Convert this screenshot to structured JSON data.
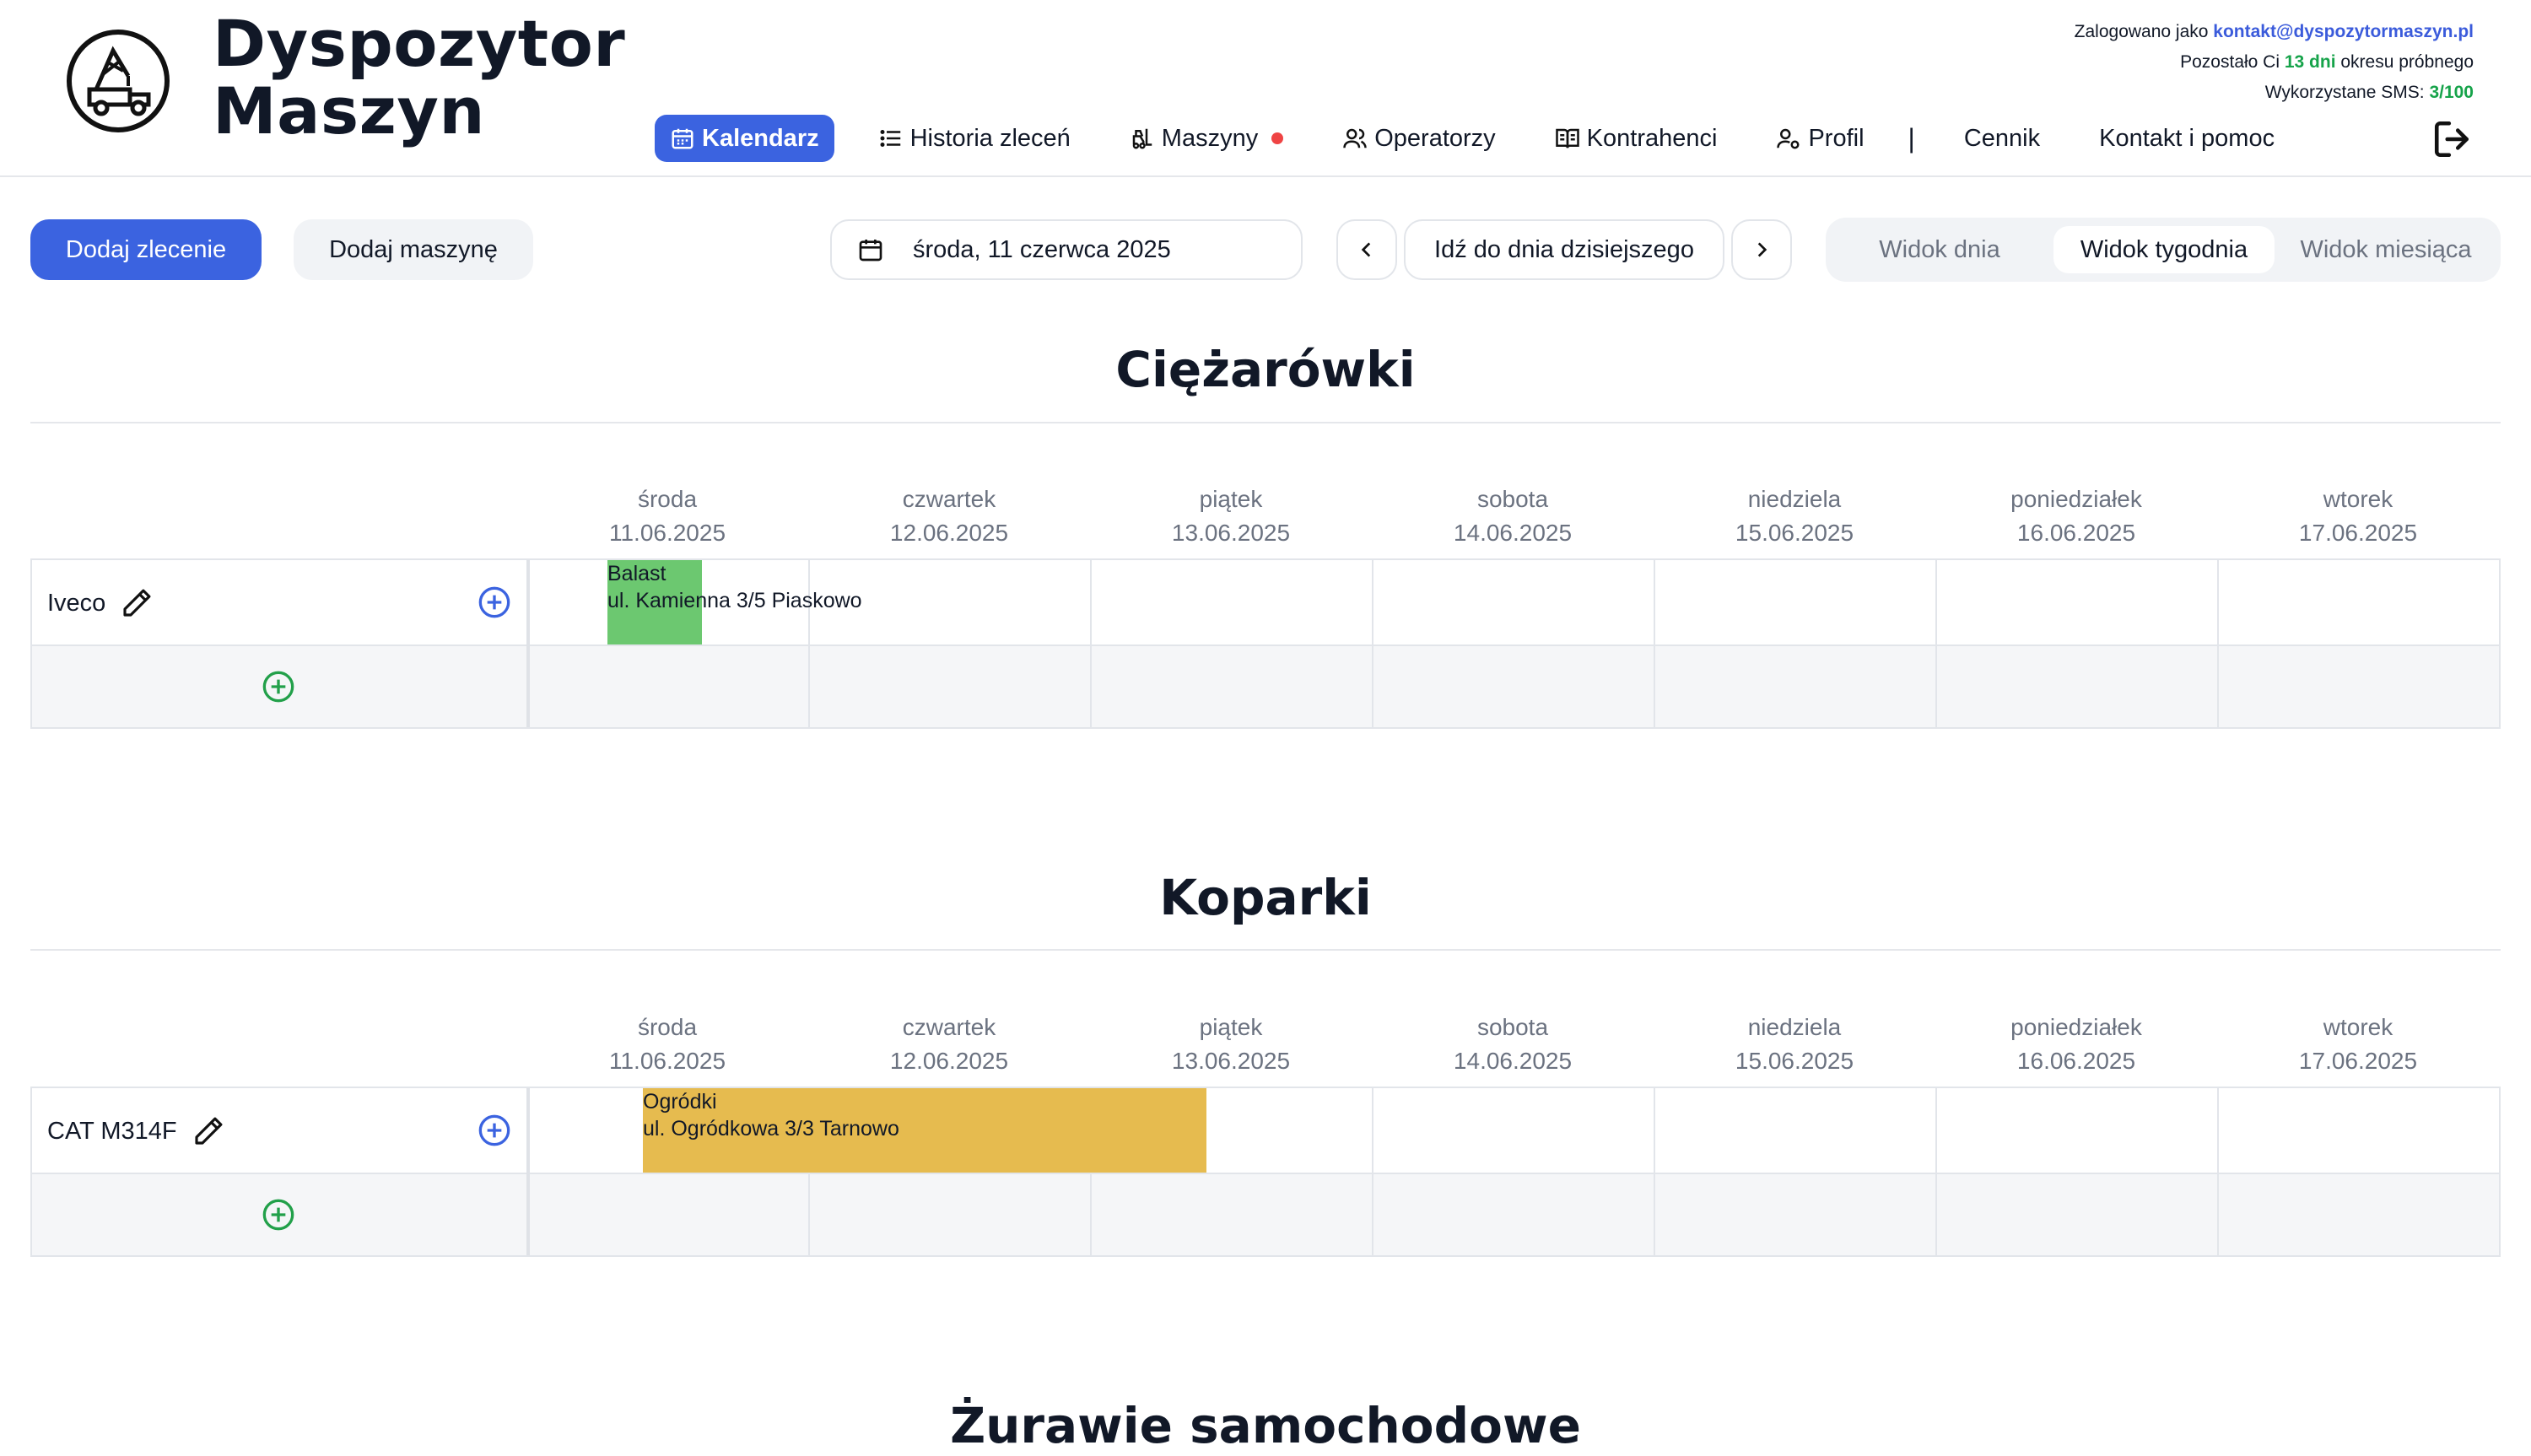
{
  "app": {
    "brand_line1": "Dyspozytor",
    "brand_line2": "Maszyn"
  },
  "account": {
    "logged_prefix": "Zalogowano jako ",
    "email": "kontakt@dyspozytormaszyn.pl",
    "trial_prefix": "Pozostało Ci ",
    "trial_days": "13 dni",
    "trial_suffix": " okresu próbnego",
    "sms_prefix": "Wykorzystane SMS: ",
    "sms_value": "3/100"
  },
  "nav": {
    "calendar": "Kalendarz",
    "history": "Historia zleceń",
    "machines": "Maszyny",
    "operators": "Operatorzy",
    "contractors": "Kontrahenci",
    "profile": "Profil",
    "separator": "|",
    "pricing": "Cennik",
    "contact": "Kontakt i pomoc"
  },
  "toolbar": {
    "add_order": "Dodaj zlecenie",
    "add_machine": "Dodaj maszynę",
    "date": "środa, 11 czerwca 2025",
    "today": "Idź do dnia dzisiejszego",
    "view_day": "Widok dnia",
    "view_week": "Widok tygodnia",
    "view_month": "Widok miesiąca"
  },
  "days": [
    {
      "name": "środa",
      "date": "11.06.2025"
    },
    {
      "name": "czwartek",
      "date": "12.06.2025"
    },
    {
      "name": "piątek",
      "date": "13.06.2025"
    },
    {
      "name": "sobota",
      "date": "14.06.2025"
    },
    {
      "name": "niedziela",
      "date": "15.06.2025"
    },
    {
      "name": "poniedziałek",
      "date": "16.06.2025"
    },
    {
      "name": "wtorek",
      "date": "17.06.2025"
    }
  ],
  "sections": [
    {
      "title": "Ciężarówki",
      "machine": "Iveco",
      "event": {
        "title": "Balast",
        "address": "ul. Kamienna 3/5 Piaskowo",
        "color": "#6cc870"
      }
    },
    {
      "title": "Koparki",
      "machine": "CAT M314F",
      "event": {
        "title": "Ogródki",
        "address": "ul. Ogródkowa 3/3 Tarnowo",
        "color": "#e6bb4f"
      }
    },
    {
      "title": "Żurawie samochodowe"
    }
  ],
  "colors": {
    "primary": "#3b63e0",
    "trial_green": "#16a34a",
    "dot_red": "#ef4444"
  }
}
